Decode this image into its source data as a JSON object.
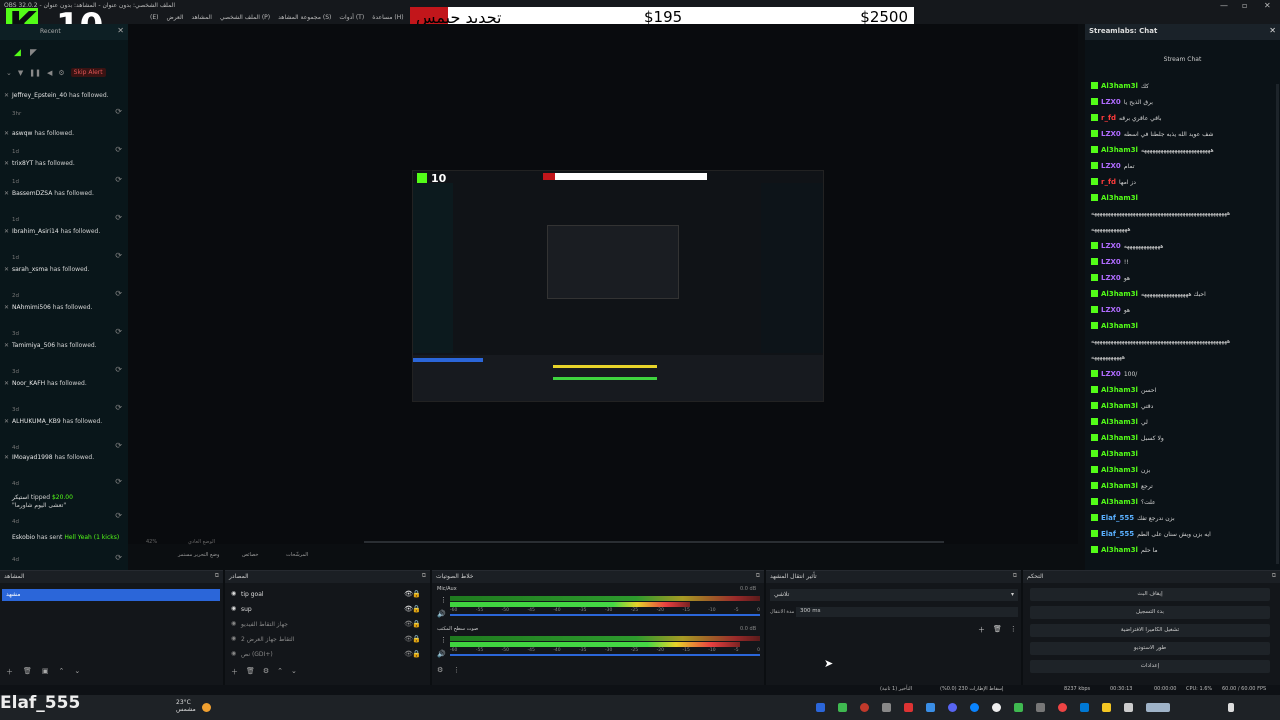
{
  "window": {
    "title": "OBS 32.0.2 - الملف الشخصي: بدون عنوان - المشاهد: بدون عنوان"
  },
  "menubar": {
    "items": [
      "Streamlabs",
      "مساعدة (H)",
      "أدوات (T)",
      "مجموعة المشاهد (S)",
      "الملف الشخصي (P)",
      "المشاهد",
      "العرض",
      "(E)"
    ]
  },
  "logo": {
    "k": "K",
    "number": "10"
  },
  "goal_bar": {
    "renew_text": "تجديد جيمس",
    "current": "$195",
    "target": "$2500"
  },
  "alerts": {
    "skip_label": "Skip Alert",
    "panel_title": "Recent",
    "events": [
      {
        "name": "Jeffrey_Epstein_40",
        "action": "has followed.",
        "time": "3hr"
      },
      {
        "name": "aswqw",
        "action": "has followed.",
        "time": "1d"
      },
      {
        "name": "trix8YT",
        "action": "has followed.",
        "time": "1d"
      },
      {
        "name": "BassemDZSA",
        "action": "has followed.",
        "time": "1d"
      },
      {
        "name": "Ibrahim_Asiri14",
        "action": "has followed.",
        "time": "1d"
      },
      {
        "name": "sarah_xsma",
        "action": "has followed.",
        "time": "2d"
      },
      {
        "name": "NAhmimi506",
        "action": "has followed.",
        "time": "3d"
      },
      {
        "name": "Tamimiya_506",
        "action": "has followed.",
        "time": "3d"
      },
      {
        "name": "Noor_KAFH",
        "action": "has followed.",
        "time": "3d"
      },
      {
        "name": "ALHUKUMA_KB9",
        "action": "has followed.",
        "time": "4d"
      },
      {
        "name": "IMoayad1998",
        "action": "has followed.",
        "time": "4d"
      }
    ],
    "tip": {
      "name": "استيكر",
      "action": "tipped",
      "amount": "$20.00",
      "message": "\"تعشى اليوم شاورما\"",
      "time": "4d"
    },
    "kick": {
      "name": "Eskobio",
      "action": "has sent",
      "text": "Hell Yeah (1 kicks)",
      "time": "4d"
    }
  },
  "chat": {
    "header": "Streamlabs: Chat",
    "subtitle": "Stream Chat",
    "messages": [
      {
        "user": "Al3ham3l",
        "color": "#53fc18",
        "text": "كك"
      },
      {
        "user": "LZX0",
        "color": "#b06cff",
        "text": "برق الذيح يا"
      },
      {
        "user": "r_fd",
        "color": "#ff3b3b",
        "text": "باقي عاقري برقه"
      },
      {
        "user": "LZX0",
        "color": "#b06cff",
        "text": "شف عويد الله يذبه جلطنا في اسطه"
      },
      {
        "user": "Al3ham3l",
        "color": "#53fc18",
        "text": "هههههههههههههههههههههههههه"
      },
      {
        "user": "LZX0",
        "color": "#b06cff",
        "text": "تمام"
      },
      {
        "user": "r_fd",
        "color": "#ff3b3b",
        "text": "دز امها"
      },
      {
        "user": "Al3ham3l",
        "color": "#53fc18",
        "text": ""
      },
      {
        "user": "",
        "color": "#cccccc",
        "text": "هههههههههههههههههههههههههههههههههههههههههههههههههه"
      },
      {
        "user": "",
        "color": "#cccccc",
        "text": "هههههههههههههه"
      },
      {
        "user": "LZX0",
        "color": "#b06cff",
        "text": "هههههههههههههه"
      },
      {
        "user": "LZX0",
        "color": "#b06cff",
        "text": "!!"
      },
      {
        "user": "LZX0",
        "color": "#b06cff",
        "text": "هو"
      },
      {
        "user": "Al3ham3l",
        "color": "#53fc18",
        "text": "احبك هههههههههههههههههه"
      },
      {
        "user": "LZX0",
        "color": "#b06cff",
        "text": "هو"
      },
      {
        "user": "Al3ham3l",
        "color": "#53fc18",
        "text": ""
      },
      {
        "user": "",
        "color": "#cccccc",
        "text": "هههههههههههههههههههههههههههههههههههههههههههههههههه"
      },
      {
        "user": "",
        "color": "#cccccc",
        "text": "هههههههههههه"
      },
      {
        "user": "LZX0",
        "color": "#b06cff",
        "text": "100/"
      },
      {
        "user": "Al3ham3l",
        "color": "#53fc18",
        "text": "احسن"
      },
      {
        "user": "Al3ham3l",
        "color": "#53fc18",
        "text": "دقتي"
      },
      {
        "user": "Al3ham3l",
        "color": "#53fc18",
        "text": "لي"
      },
      {
        "user": "Al3ham3l",
        "color": "#53fc18",
        "text": "ولا كسبل"
      },
      {
        "user": "Al3ham3l",
        "color": "#53fc18",
        "text": ""
      },
      {
        "user": "Al3ham3l",
        "color": "#53fc18",
        "text": "بزن"
      },
      {
        "user": "Al3ham3l",
        "color": "#53fc18",
        "text": "ترجع"
      },
      {
        "user": "Al3ham3l",
        "color": "#53fc18",
        "text": "علت؟"
      },
      {
        "user": "Elaf_555",
        "color": "#5ab0ff",
        "text": "بزن ندرجع تفك"
      },
      {
        "user": "Elaf_555",
        "color": "#5ab0ff",
        "text": "ايه بزن ويش سنان على الطم"
      },
      {
        "user": "Al3ham3l",
        "color": "#53fc18",
        "text": "ما حلم"
      }
    ]
  },
  "preview": {
    "zoom": "42%",
    "footer": "الوضع العادي"
  },
  "scene_toolbar": {
    "studio_mode": "وضع التحرير مستمر",
    "settings": "خصائص",
    "filters": "المرشّحات"
  },
  "docks": {
    "scenes": {
      "title": "المشاهد",
      "selected": "مشهد"
    },
    "sources": {
      "title": "المصادر",
      "items": [
        {
          "name": "tip goal",
          "dim": false
        },
        {
          "name": "sup",
          "dim": false
        },
        {
          "name": "جهاز التقاط الفيديو",
          "dim": true
        },
        {
          "name": "التقاط جهاز العرض 2",
          "dim": true
        },
        {
          "name": "نص (GDI+)",
          "dim": true
        }
      ]
    },
    "mixer": {
      "title": "خلاط الصوتيات",
      "tracks": [
        {
          "name": "Mic/Aux",
          "db": "0.0 dB"
        },
        {
          "name": "صوت سطح المكتب",
          "db": "0.0 dB"
        }
      ],
      "scale": [
        "-60",
        "-55",
        "-50",
        "-45",
        "-40",
        "-35",
        "-30",
        "-25",
        "-20",
        "-15",
        "-10",
        "-5",
        "0"
      ]
    },
    "transitions": {
      "title": "تأثير انتقال المشهد",
      "type": "تلاشي",
      "duration_label": "مدة الانتقال",
      "duration": "300 ms"
    },
    "controls": {
      "title": "التحكم",
      "buttons": [
        "إيقاف البث",
        "بدء التسجيل",
        "تشغيل الكاميرا الافتراضية",
        "طور الاستوديو",
        "إعدادات"
      ]
    }
  },
  "status": {
    "cpu": "CPU: 1.6%",
    "fps": "60.00 / 60.00 FPS",
    "rec": "00:00:00",
    "live": "00:30:13",
    "bitrate": "8237 kbps",
    "dropped": "إسقاط الإطارات 230 (0.0%)",
    "frames": "التأخير (1 ثانية)"
  },
  "taskbar": {
    "user_tag": "Elaf_555",
    "temp": "23°C",
    "weather": "مشمس"
  },
  "colors": {
    "kick_green": "#53fc18",
    "accent_blue": "#2b66d9",
    "goal_red": "#c2161b"
  }
}
